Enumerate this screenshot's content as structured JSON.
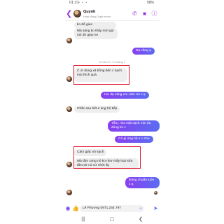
{
  "status": {
    "time": "01:21",
    "battery": "58%"
  },
  "header": {
    "contact_name": "Quynh",
    "subtitle": "Hoạt động 3 giờ trước",
    "icons": [
      "back-arrow-icon",
      "phone-icon",
      "video-icon",
      "info-icon"
    ]
  },
  "messages": [
    {
      "side": "left",
      "text": "ko để giao"
    },
    {
      "side": "left",
      "text": "Mà sáng ko thấy mời gọi nói 3h giao ne"
    },
    {
      "side": "right",
      "text": "Dạ vâng ạ"
    },
    {
      "side": "time",
      "text": "12:36 CH, 17 tháng 1"
    },
    {
      "side": "left",
      "text": "C ơi dùng xả bông bên c sạch mà thích quá",
      "highlight": true
    },
    {
      "side": "right",
      "text": "Hic dạ vâng em cảm ơn c ạ"
    },
    {
      "side": "left",
      "text": "Chắc sau hết e ủng hộ tiếp"
    },
    {
      "side": "right",
      "text": "Tắm, rửa mặt sạch mịn da đúng ko c"
    },
    {
      "side": "right",
      "text": "Có gì ủng hộ e c nha"
    },
    {
      "side": "left",
      "text": "Cảm giác nó sạch",
      "highlight": true
    },
    {
      "side": "left",
      "text": "Mà tắm xong nó ko như mấy loại sữa tắm,sờ nó cứ nhớt ấy",
      "highlight": true
    },
    {
      "side": "right",
      "text": "Đúng chuẩn luôn c ạ"
    }
  ],
  "composer": {
    "value": "Lê Phương 0971.244.797",
    "icons": [
      "camera-icon",
      "like-icon",
      "emoji-icon",
      "send-icon"
    ]
  },
  "nav": [
    "recent-apps-icon",
    "home-icon",
    "back-icon"
  ]
}
